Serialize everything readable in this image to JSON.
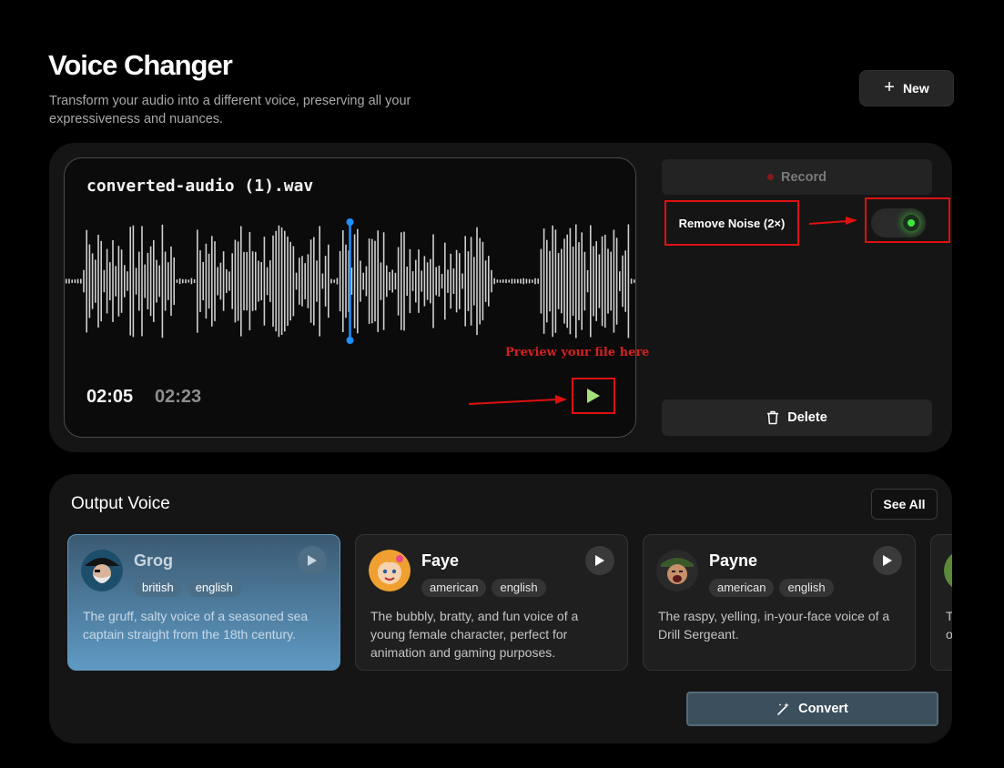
{
  "header": {
    "title": "Voice Changer",
    "subtitle": "Transform your audio into a different voice, preserving all your expressiveness and nuances.",
    "new_button_label": "New"
  },
  "player": {
    "filename": "converted-audio (1).wav",
    "current_time": "02:05",
    "total_time": "02:23",
    "progress": 0.5
  },
  "controls": {
    "record_label": "Record",
    "remove_noise_label": "Remove Noise (2×)",
    "remove_noise_enabled": true,
    "delete_label": "Delete"
  },
  "annotations": {
    "preview_hint": "Preview your file here"
  },
  "output": {
    "title": "Output Voice",
    "see_all_label": "See All",
    "convert_label": "Convert",
    "voices": [
      {
        "name": "Grog",
        "tags": [
          "british",
          "english"
        ],
        "description": "The gruff, salty voice of a seasoned sea captain straight from the 18th century.",
        "selected": true
      },
      {
        "name": "Faye",
        "tags": [
          "american",
          "english"
        ],
        "description": "The bubbly, bratty, and fun voice of a young female character, perfect for animation and gaming purposes.",
        "selected": false
      },
      {
        "name": "Payne",
        "tags": [
          "american",
          "english"
        ],
        "description": "The raspy, yelling, in-your-face voice of a Drill Sergeant.",
        "selected": false
      },
      {
        "name": "",
        "tags": [],
        "description": "T\no",
        "selected": false
      }
    ]
  },
  "colors": {
    "playhead": "#1e90ff",
    "play_icon": "#a4e07c",
    "annotation": "#e01010",
    "toggle_on": "#3ee83e",
    "selected_card_top": "#3b5a72",
    "selected_card_bottom": "#5f9ac4"
  }
}
